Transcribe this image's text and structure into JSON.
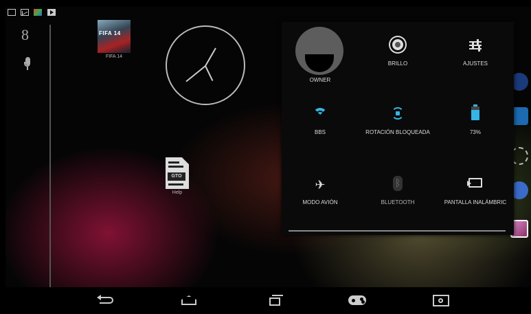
{
  "desktop": {
    "apps": [
      {
        "label": "FIFA 14",
        "art_text": "FIFA 14"
      },
      {
        "label": "Help",
        "art_text": "GTO"
      }
    ]
  },
  "search": {
    "google_glyph": "8"
  },
  "quick_settings": {
    "owner": {
      "label": "OWNER"
    },
    "brightness": {
      "label": "BRILLO"
    },
    "settings": {
      "label": "AJUSTES"
    },
    "wifi": {
      "label": "BBS"
    },
    "rotation": {
      "label": "ROTACIÓN BLOQUEADA"
    },
    "battery": {
      "label": "73%",
      "level": 0.73
    },
    "airplane": {
      "label": "MODO AVIÓN",
      "glyph": "✈"
    },
    "bluetooth": {
      "label": "BLUETOOTH"
    },
    "cast": {
      "label": "PANTALLA INALÁMBRIC"
    }
  },
  "colors": {
    "accent": "#35b5e5",
    "panel_bg": "#0a0a0a"
  }
}
